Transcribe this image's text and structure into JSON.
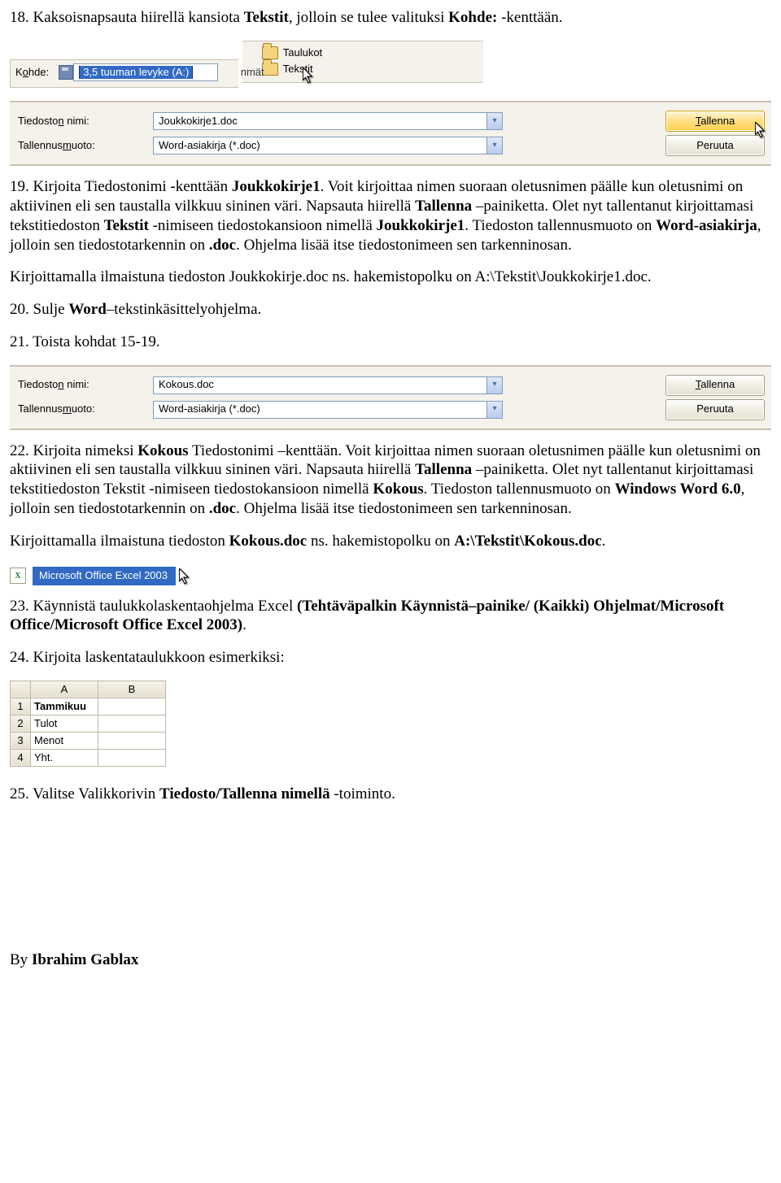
{
  "step18": {
    "prefix": "18. Kaksoisnapsauta hiirellä kansiota ",
    "bold1": "Tekstit",
    "mid": ", jolloin se tulee valituksi ",
    "bold2": "Kohde:",
    "suffix": " -kenttään."
  },
  "topPanel": {
    "label": "Kohde:",
    "accessKey": "o",
    "value": "3,5 tuuman levyke (A:)"
  },
  "folders": {
    "item1": "Taulukot",
    "item2": "Tekstit",
    "leftEdge": "nmät"
  },
  "saveas1": {
    "nameLabel": {
      "pre": "Tiedosto",
      "u": "n",
      "post": " nimi:"
    },
    "formatLabel": {
      "pre": "Tallennus",
      "u": "m",
      "post": "uoto:"
    },
    "filename": "Joukkokirje1.doc",
    "format": "Word-asiakirja (*.doc)",
    "btnSave": "Tallenna",
    "btnSaveU": "T",
    "btnCancel": "Peruuta"
  },
  "step19": {
    "prefix": "19. Kirjoita Tiedostonimi -kenttään ",
    "bold1": "Joukkokirje1",
    "mid1": ". Voit kirjoittaa nimen suoraan oletusnimen päälle kun oletusnimi on aktiivinen eli sen taustalla vilkkuu sininen väri. Napsauta hiirellä ",
    "bold2": "Tallenna",
    "mid2": " –painiketta. Olet nyt tallentanut kirjoittamasi tekstitiedoston ",
    "bold3": "Tekstit",
    "mid3": " -nimiseen tiedostokansioon nimellä ",
    "bold4": "Joukkokirje1",
    "mid4": ". Tiedoston tallennusmuoto on ",
    "bold5": "Word-asiakirja",
    "mid5": ", jolloin sen tiedostotarkennin on ",
    "bold6": ".doc",
    "suffix": ". Ohjelma lisää itse tiedostonimeen sen tarkenninosan."
  },
  "para1": {
    "pre": "Kirjoittamalla ilmaistuna tiedoston Joukkokirje.doc ns. hakemistopolku on ",
    "path": "A:\\Tekstit\\Joukkokirje1.doc."
  },
  "step20": {
    "pre": "20. Sulje ",
    "bold": "Word",
    "post": "–tekstinkäsittelyohjelma."
  },
  "step21": "21. Toista kohdat 15-19.",
  "saveas2": {
    "filename": "Kokous.doc",
    "format": "Word-asiakirja (*.doc)",
    "btnSave": "Tallenna",
    "btnCancel": "Peruuta"
  },
  "step22": {
    "pre": "22. Kirjoita nimeksi ",
    "b1": "Kokous",
    "m1": " Tiedostonimi –kenttään. Voit kirjoittaa nimen suoraan oletusnimen päälle kun oletusnimi on aktiivinen eli sen taustalla vilkkuu sininen väri. Napsauta hiirellä ",
    "b2": "Tallenna",
    "m2": " –painiketta. Olet nyt tallentanut kirjoittamasi tekstitiedoston Tekstit -nimiseen tiedostokansioon nimellä ",
    "b3": "Kokous",
    "m3": ". Tiedoston tallennusmuoto on ",
    "b4": "Windows Word 6.0",
    "m4": ", jolloin sen tiedostotarkennin on ",
    "b5": ".doc",
    "post": ". Ohjelma lisää itse tiedostonimeen sen tarkenninosan."
  },
  "para2": {
    "pre": "Kirjoittamalla ilmaistuna tiedoston ",
    "b1": "Kokous.doc",
    "m1": " ns. hakemistopolku on ",
    "b2": "A:\\Tekstit\\Kokous.doc",
    "post": "."
  },
  "excelMenu": "Microsoft Office Excel 2003",
  "step23": {
    "pre": "23. Käynnistä taulukkolaskentaohjelma Excel ",
    "b1": "(Tehtäväpalkin Käynnistä–painike/ (Kaikki) Ohjelmat/Microsoft Office/Microsoft Office Excel 2003)",
    "post": "."
  },
  "step24": "24. Kirjoita laskentataulukkoon esimerkiksi:",
  "sheet": {
    "cols": [
      "",
      "A",
      "B"
    ],
    "rows": [
      {
        "n": "1",
        "a": "Tammikuu",
        "b": "",
        "bold": true
      },
      {
        "n": "2",
        "a": "Tulot",
        "b": ""
      },
      {
        "n": "3",
        "a": "Menot",
        "b": ""
      },
      {
        "n": "4",
        "a": "Yht.",
        "b": ""
      }
    ]
  },
  "step25": {
    "pre": "25. Valitse Valikkorivin ",
    "b1": "Tiedosto/Tallenna nimellä",
    "post": " -toiminto."
  },
  "byline": {
    "pre": "By ",
    "bold": "Ibrahim Gablax"
  }
}
